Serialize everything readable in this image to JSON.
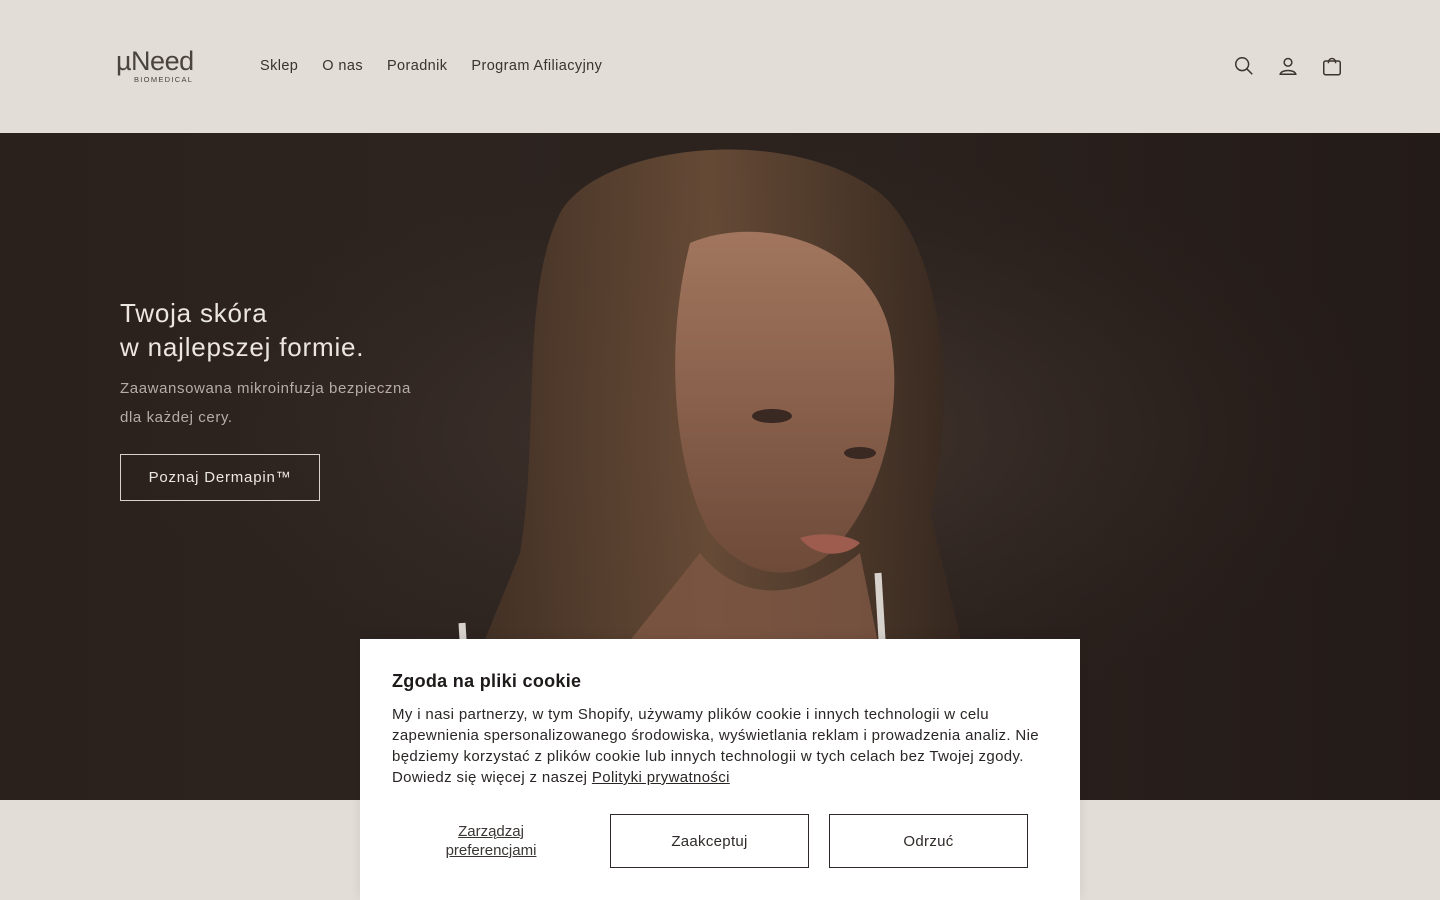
{
  "header": {
    "logo_main": "µNeed",
    "logo_sub": "BIOMEDICAL",
    "nav": [
      "Sklep",
      "O nas",
      "Poradnik",
      "Program Afiliacyjny"
    ],
    "icons": [
      "search-icon",
      "account-icon",
      "cart-icon"
    ]
  },
  "hero": {
    "title_line1": "Twoja skóra",
    "title_line2": "w najlepszej formie.",
    "subtitle_line1": "Zaawansowana mikroinfuzja bezpieczna",
    "subtitle_line2": "dla każdej cery.",
    "cta": "Poznaj Dermapin™"
  },
  "cookie": {
    "title": "Zgoda na pliki cookie",
    "text": "My i nasi partnerzy, w tym Shopify, używamy plików cookie i innych technologii w celu zapewnienia spersonalizowanego środowiska, wyświetlania reklam i prowadzenia analiz. Nie będziemy korzystać z plików cookie lub innych technologii w tych celach bez Twojej zgody. Dowiedz się więcej z naszej ",
    "link": "Polityki prywatności",
    "manage": "Zarządzaj preferencjami",
    "accept": "Zaakceptuj",
    "reject": "Odrzuć"
  },
  "colors": {
    "header_bg": "#e2ddd6",
    "hero_bg": "#2b221e",
    "dialog_bg": "#ffffff"
  }
}
